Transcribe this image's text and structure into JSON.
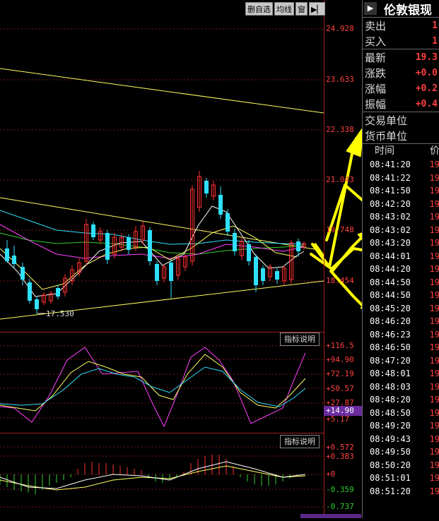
{
  "toolbar": {
    "b1": "删自选",
    "b2": "均线",
    "b3": "窗",
    "b4": "▶▏"
  },
  "axis_main": [
    "24.928",
    "23.633",
    "22.338",
    "21.043",
    "19.748",
    "18.454"
  ],
  "low_label": "17.530",
  "axis_kdj": [
    "+116.5",
    "+94.90",
    "+72.19",
    "+50.57",
    "+27.87",
    "+5.17"
  ],
  "kdj_current": "+14.90",
  "axis_macd_pos": [
    "+0.572",
    "+0.383",
    "+0"
  ],
  "axis_macd_neg": [
    "-0.359",
    "-0.737"
  ],
  "indicator_btn": "指标说明",
  "panel": {
    "arrow": "▶",
    "title": "伦敦银现",
    "quotes": [
      {
        "k": "卖出",
        "v": "1"
      },
      {
        "k": "买入",
        "v": "1"
      },
      {
        "k": "最新",
        "v": "19.3"
      },
      {
        "k": "涨跌",
        "v": "+0.0"
      },
      {
        "k": "涨幅",
        "v": "+0.2"
      },
      {
        "k": "振幅",
        "v": "+0.4"
      }
    ],
    "unit_trade": "交易单位",
    "unit_currency": "货币单位",
    "col_time": "时间",
    "col_price": "价",
    "ticks": [
      {
        "t": "08:41:20",
        "p": "19"
      },
      {
        "t": "08:41:22",
        "p": "19"
      },
      {
        "t": "08:41:50",
        "p": "19"
      },
      {
        "t": "08:42:20",
        "p": "19"
      },
      {
        "t": "08:43:02",
        "p": "19"
      },
      {
        "t": "08:43:02",
        "p": "19"
      },
      {
        "t": "08:43:20",
        "p": "19"
      },
      {
        "t": "08:44:01",
        "p": "19"
      },
      {
        "t": "08:44:20",
        "p": "19"
      },
      {
        "t": "08:44:50",
        "p": "19"
      },
      {
        "t": "08:44:50",
        "p": "19"
      },
      {
        "t": "08:45:20",
        "p": "19"
      },
      {
        "t": "08:46:20",
        "p": "19"
      },
      {
        "t": "08:46:23",
        "p": "19"
      },
      {
        "t": "08:46:50",
        "p": "19"
      },
      {
        "t": "08:47:20",
        "p": "19"
      },
      {
        "t": "08:48:01",
        "p": "19"
      },
      {
        "t": "08:48:03",
        "p": "19"
      },
      {
        "t": "08:48:20",
        "p": "19"
      },
      {
        "t": "08:48:50",
        "p": "19"
      },
      {
        "t": "08:49:20",
        "p": "19"
      },
      {
        "t": "08:49:43",
        "p": "19"
      },
      {
        "t": "08:49:50",
        "p": "19"
      },
      {
        "t": "08:50:20",
        "p": "19"
      },
      {
        "t": "08:51:01",
        "p": "19"
      },
      {
        "t": "08:51:20",
        "p": "19"
      }
    ]
  },
  "colors": {
    "up": "#ff3030",
    "down": "#30e0ff",
    "trend": "#ffff60",
    "grid": "#a02020",
    "arrow": "#ffff00"
  }
}
